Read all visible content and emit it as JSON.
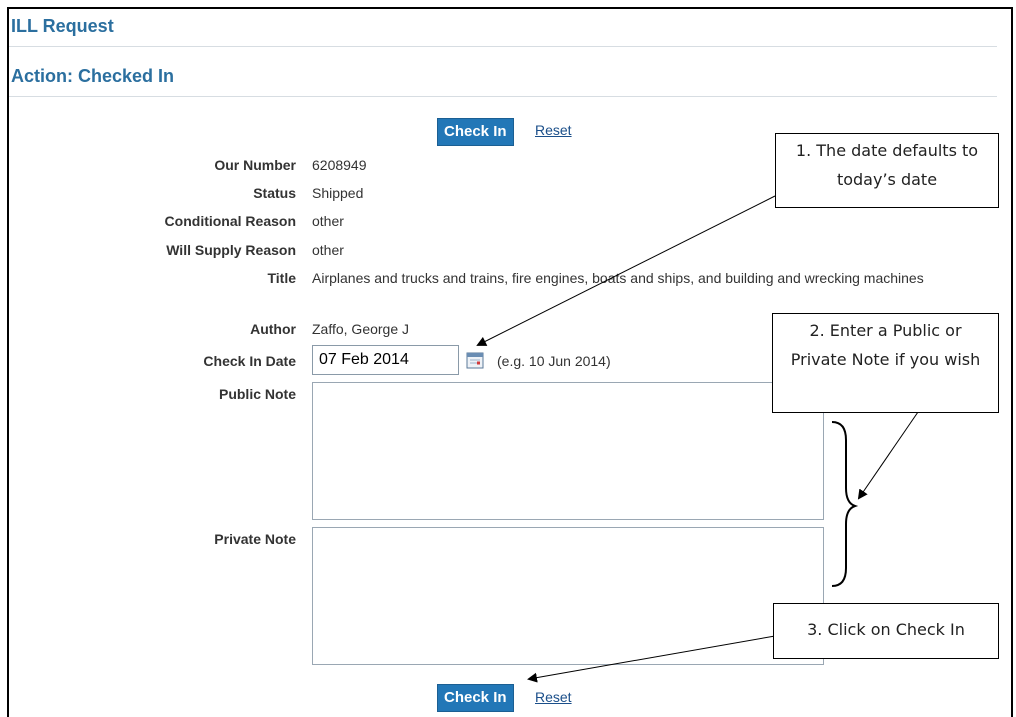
{
  "header": {
    "title": "ILL Request",
    "action": "Action: Checked In"
  },
  "buttons": {
    "check_in": "Check In",
    "reset": "Reset"
  },
  "fields": {
    "our_number": {
      "label": "Our Number",
      "value": "6208949"
    },
    "status": {
      "label": "Status",
      "value": "Shipped"
    },
    "conditional_reason": {
      "label": "Conditional Reason",
      "value": "other"
    },
    "will_supply_reason": {
      "label": "Will Supply Reason",
      "value": "other"
    },
    "title": {
      "label": "Title",
      "value": "Airplanes and trucks and trains, fire engines, boats and ships, and building and wrecking machines"
    },
    "author": {
      "label": "Author",
      "value": "Zaffo, George J"
    },
    "check_in_date": {
      "label": "Check In Date",
      "value": "07 Feb 2014",
      "hint": "(e.g. 10 Jun 2014)"
    },
    "public_note": {
      "label": "Public Note",
      "value": ""
    },
    "private_note": {
      "label": "Private Note",
      "value": ""
    }
  },
  "callouts": {
    "c1": "1. The date defaults to today’s date",
    "c2": "2. Enter a Public or Private Note if you wish",
    "c3": "3. Click on Check In"
  },
  "icons": {
    "calendar": "calendar-icon"
  },
  "colors": {
    "heading": "#2b6f9f",
    "button_bg": "#2277b7",
    "link": "#1b4f8a"
  }
}
